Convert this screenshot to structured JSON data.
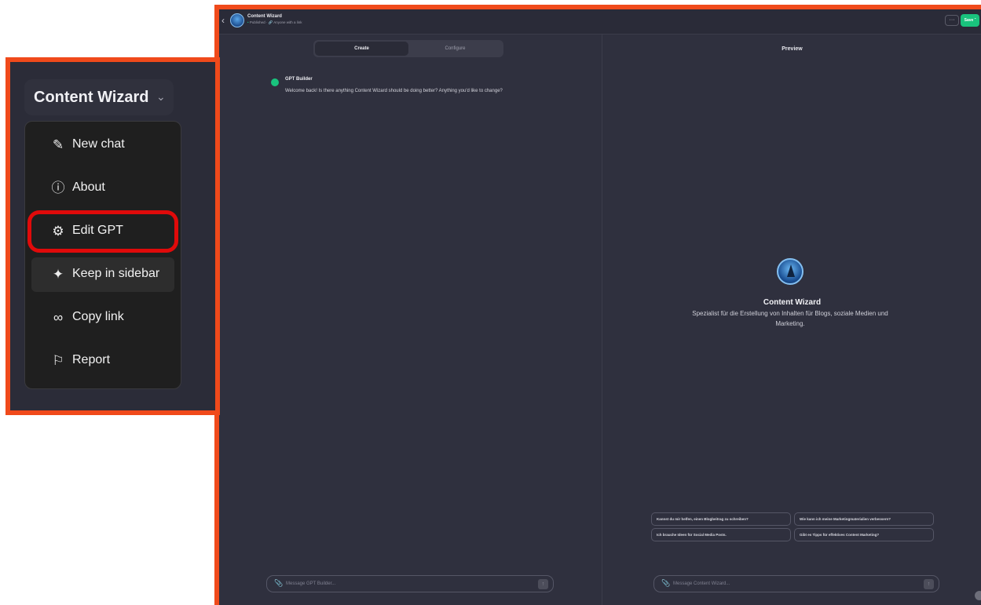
{
  "header": {
    "back_icon": "chevron-left-icon",
    "gpt_name": "Content Wizard",
    "status_published": "Published",
    "status_sharing": "Anyone with a link",
    "more_label": "···",
    "save_label": "Save"
  },
  "builder": {
    "tabs": [
      {
        "label": "Create",
        "active": true
      },
      {
        "label": "Configure",
        "active": false
      }
    ],
    "message": {
      "author": "GPT Builder",
      "text": "Welcome back! Is there anything Content Wizard should be doing better? Anything you'd like to change?"
    },
    "composer": {
      "placeholder": "Message GPT Builder..."
    }
  },
  "preview": {
    "label": "Preview",
    "gpt_name": "Content Wizard",
    "description": "Spezialist für die Erstellung von Inhalten für Blogs, soziale Medien und Marketing.",
    "suggestions": [
      "Kannst du mir helfen, einen Blogbeitrag zu schreiben?",
      "Wie kann ich meine Marketingmaterialien verbessern?",
      "Ich brauche Ideen für Social Media Posts.",
      "Gibt es Tipps für effektives Content Marketing?"
    ],
    "composer": {
      "placeholder": "Message Content Wizard..."
    }
  },
  "dropdown": {
    "title": "Content Wizard",
    "items": [
      {
        "label": "New chat",
        "icon": "edit-icon"
      },
      {
        "label": "About",
        "icon": "info-icon"
      },
      {
        "label": "Edit GPT",
        "icon": "gear-icon"
      },
      {
        "label": "Keep in sidebar",
        "icon": "pin-icon"
      },
      {
        "label": "Copy link",
        "icon": "link-icon"
      },
      {
        "label": "Report",
        "icon": "flag-icon"
      }
    ]
  },
  "colors": {
    "frame_border": "#f04a1b",
    "highlight": "#e00a0a",
    "accent_green": "#19c37d",
    "panel_bg": "#2f303e"
  }
}
